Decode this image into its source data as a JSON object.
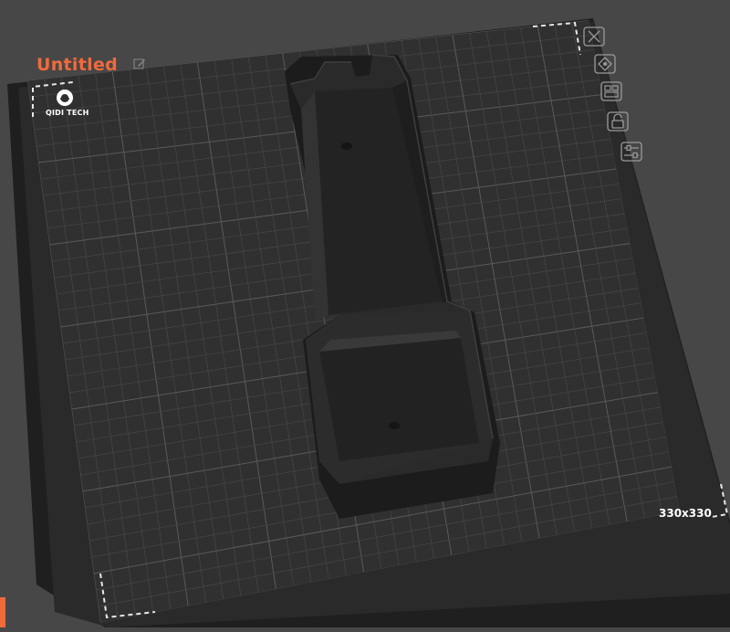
{
  "project": {
    "title": "Untitled"
  },
  "plate": {
    "size_label": "330x330",
    "brand": "QIDI TECH"
  },
  "toolbar": [
    {
      "name": "close-icon"
    },
    {
      "name": "orient-icon"
    },
    {
      "name": "arrange-icon"
    },
    {
      "name": "lock-icon"
    },
    {
      "name": "settings-sliders-icon"
    }
  ],
  "colors": {
    "background": "#474747",
    "plate": "#2f2f2f",
    "grid": "#4c4c4c",
    "accent": "#f06a3c",
    "model": "#262626"
  }
}
